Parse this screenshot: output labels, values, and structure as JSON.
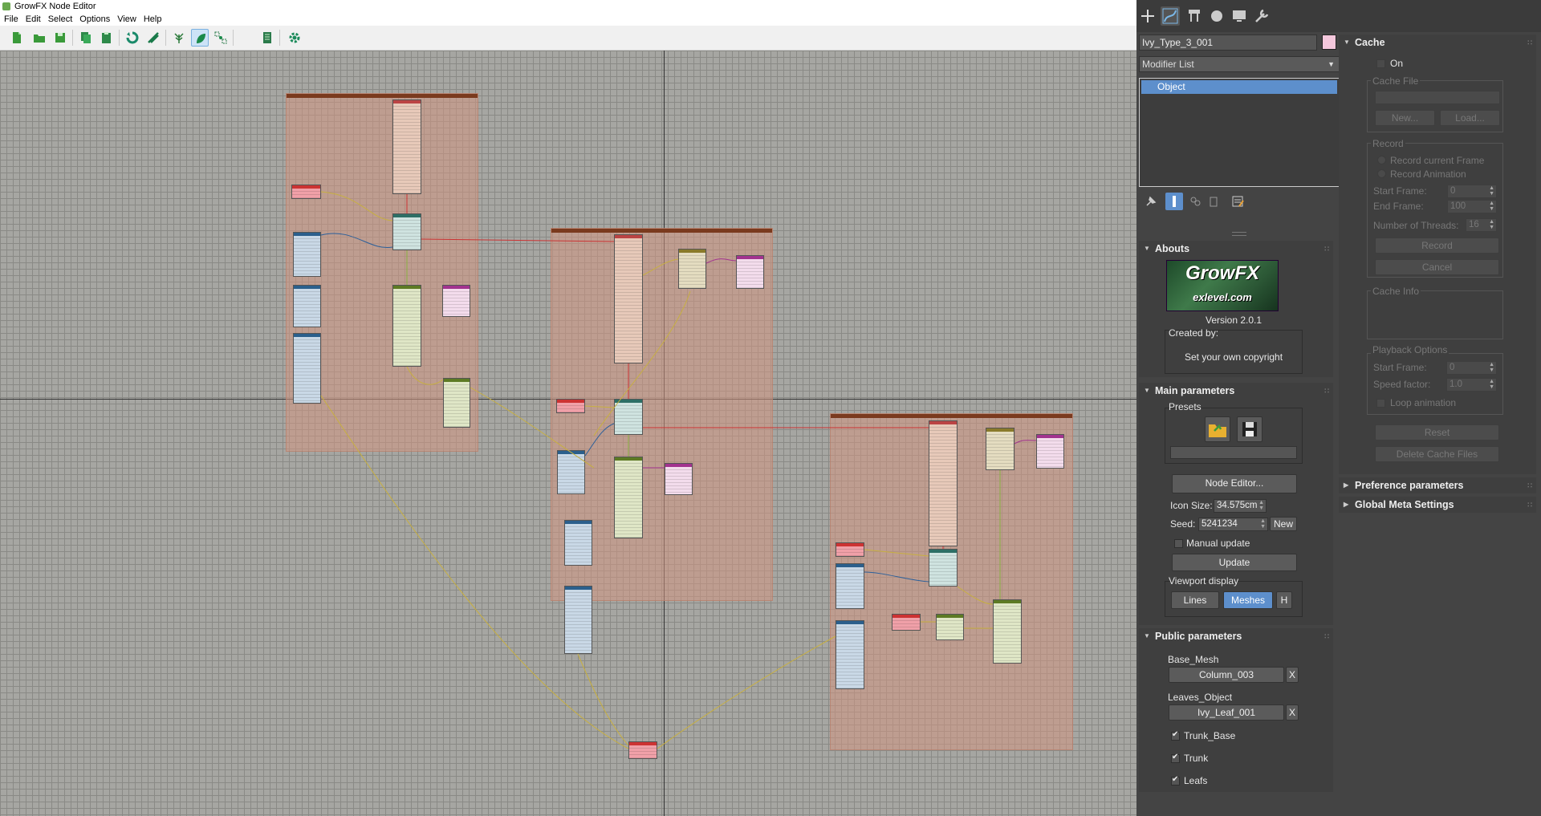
{
  "window": {
    "title": "GrowFX Node Editor"
  },
  "menu": [
    "File",
    "Edit",
    "Select",
    "Options",
    "View",
    "Help"
  ],
  "toolbar": {
    "icons": [
      "new-file-icon",
      "open-folder-icon",
      "save-icon",
      "copy-icon",
      "paste-icon",
      "refresh-icon",
      "link-icon",
      "tree-icon",
      "leaf-icon",
      "graph-icon",
      "list-icon",
      "gear-icon"
    ],
    "active": "leaf-icon"
  },
  "colors": {
    "accent": "#5d8fcc",
    "group": "#d2967f",
    "group_header": "#7a3a1e",
    "object_swatch": "#f4c7dc"
  },
  "panel": {
    "object_name": "Ivy_Type_3_001",
    "modifier_list": "Modifier List",
    "stack_item": "Object",
    "abouts": {
      "header": "Abouts",
      "logo_line1": "GrowFX",
      "logo_line2": "exlevel.com",
      "version": "Version 2.0.1",
      "created_by": "Created by:",
      "copyright": "Set your own copyright"
    },
    "main": {
      "header": "Main parameters",
      "presets": "Presets",
      "node_editor": "Node Editor...",
      "icon_size_label": "Icon Size:",
      "icon_size": "34.575cm",
      "seed_label": "Seed:",
      "seed": "5241234",
      "new": "New",
      "manual_update": "Manual update",
      "update": "Update",
      "viewport_display": "Viewport display",
      "lines": "Lines",
      "meshes": "Meshes",
      "h": "H"
    },
    "public": {
      "header": "Public parameters",
      "base_mesh_label": "Base_Mesh",
      "base_mesh": "Column_003",
      "leaves_object_label": "Leaves_Object",
      "leaves_object": "Ivy_Leaf_001",
      "x": "X",
      "trunk_base": "Trunk_Base",
      "trunk": "Trunk",
      "leafs": "Leafs"
    },
    "cache": {
      "header": "Cache",
      "on": "On",
      "cache_file": "Cache File",
      "new": "New...",
      "load": "Load...",
      "record": "Record",
      "record_current": "Record current Frame",
      "record_animation": "Record Animation",
      "start_frame_label": "Start Frame:",
      "start_frame": "0",
      "end_frame_label": "End Frame:",
      "end_frame": "100",
      "threads_label": "Number of Threads:",
      "threads": "16",
      "record_btn": "Record",
      "cancel": "Cancel",
      "cache_info": "Cache Info",
      "playback_options": "Playback Options",
      "pb_start_label": "Start Frame:",
      "pb_start": "0",
      "speed_label": "Speed factor:",
      "speed": "1.0",
      "loop": "Loop animation",
      "reset": "Reset",
      "delete": "Delete Cache Files"
    },
    "preference": "Preference parameters",
    "global_meta": "Global Meta Settings"
  }
}
